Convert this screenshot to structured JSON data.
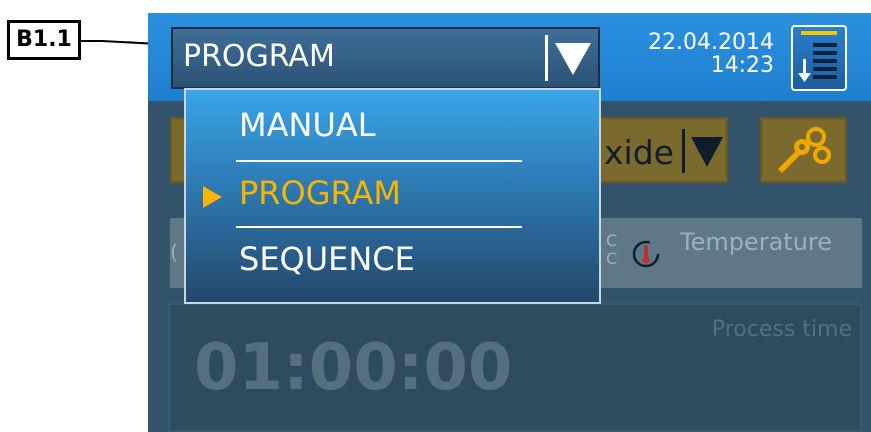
{
  "callout": {
    "label": "B1.1"
  },
  "header": {
    "mode_value": "PROGRAM",
    "date": "22.04.2014",
    "time": "14:23",
    "menu_icon": "list-menu-icon"
  },
  "dropdown": {
    "options": [
      {
        "label": "MANUAL",
        "selected": false
      },
      {
        "label": "PROGRAM",
        "selected": true
      },
      {
        "label": "SEQUENCE",
        "selected": false
      }
    ]
  },
  "background": {
    "gas_dropdown_fragment": "xide",
    "settings_icon": "wrench-gears-icon",
    "row_left_fragment": "C\nC",
    "temperature_label": "Temperature",
    "process_time_label": "Process time",
    "process_time_value": "01:00:00"
  },
  "colors": {
    "topbar": "#2b91de",
    "accent_selected": "#f7b500",
    "dim_button": "#7a6a2e"
  }
}
